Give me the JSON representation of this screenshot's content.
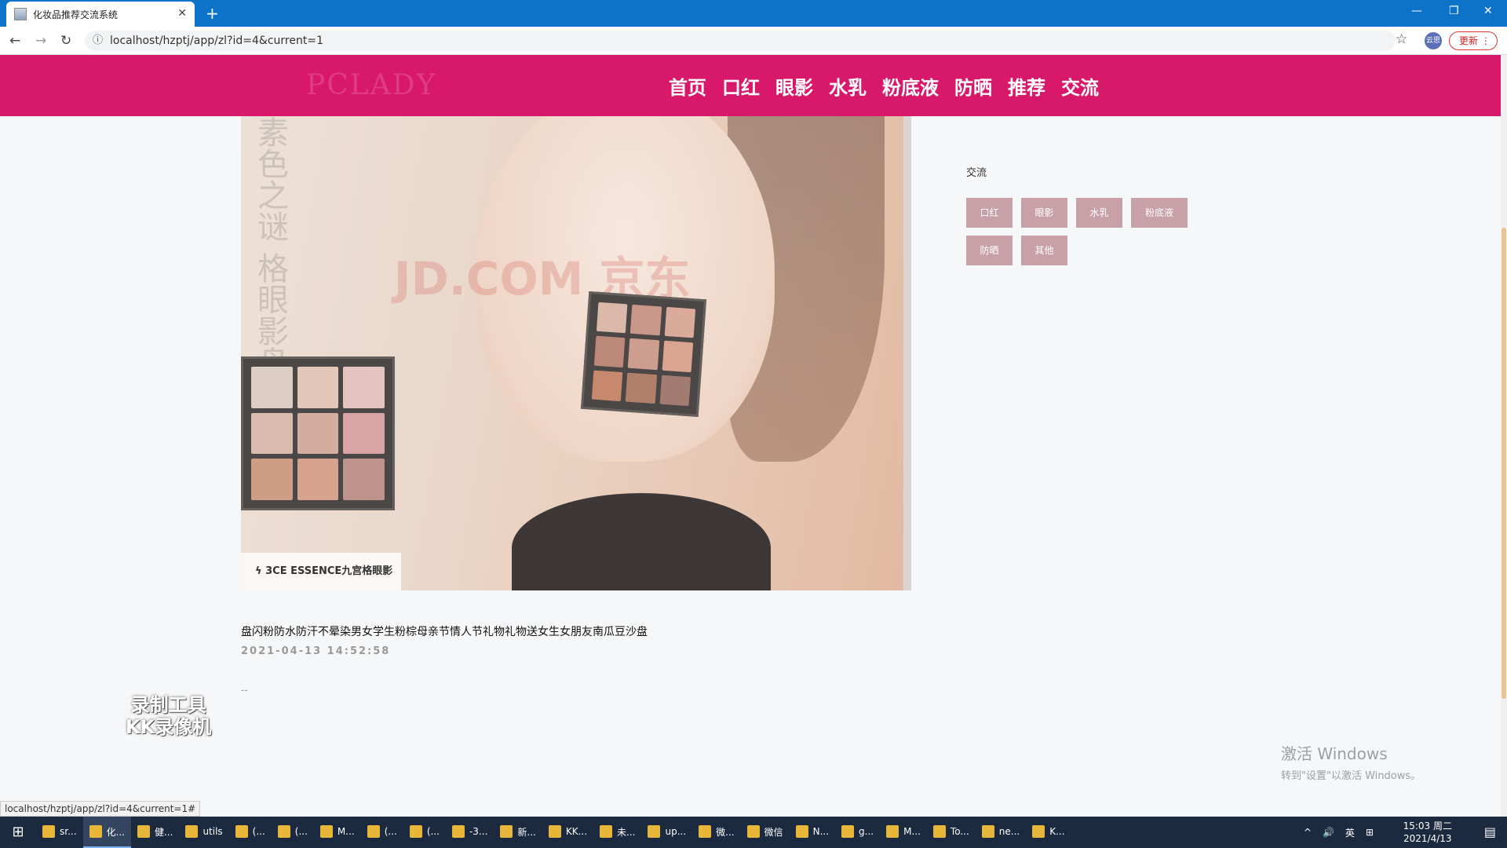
{
  "browser": {
    "tab_title": "化妆品推荐交流系统",
    "new_tab": "+",
    "url": "localhost/hzptj/app/zl?id=4&current=1",
    "update_label": "更新",
    "profile_label": "云思",
    "status_url": "localhost/hzptj/app/zl?id=4&current=1#"
  },
  "header": {
    "logo": "PCLADY",
    "nav": [
      "首页",
      "口红",
      "眼影",
      "水乳",
      "粉底液",
      "防晒",
      "推荐",
      "交流"
    ]
  },
  "hero": {
    "side_text": "素色之谜 格眼影盘",
    "watermark": "JD.COM 京东",
    "caption": "3CE ESSENCE九宫格眼影",
    "palette_label": "3CE ESSENCE"
  },
  "article": {
    "title": "盘闪粉防水防汗不晕染男女学生粉棕母亲节情人节礼物礼物送女生女朋友南瓜豆沙盘",
    "date": "2021-04-13 14:52:58",
    "body": "--"
  },
  "sidebar": {
    "title": "交流",
    "tags": [
      "口红",
      "眼影",
      "水乳",
      "粉底液",
      "防晒",
      "其他"
    ]
  },
  "overlay": {
    "recorder": "录制工具\nKK录像机",
    "activate_line1": "激活 Windows",
    "activate_line2": "转到\"设置\"以激活 Windows。"
  },
  "taskbar": {
    "items": [
      "sr...",
      "化...",
      "健...",
      "utils",
      "(...",
      "(...",
      "M...",
      "(...",
      "(...",
      "-3...",
      "新...",
      "KK...",
      "未...",
      "up...",
      "微...",
      "微信",
      "N...",
      "g...",
      "M...",
      "To...",
      "ne...",
      "K..."
    ],
    "active_index": 1,
    "tray_lang": "英",
    "time": "15:03 周二",
    "date": "2021/4/13"
  },
  "colors": {
    "brand": "#d8196b",
    "tag": "#c8a0a7",
    "titlebar": "#0c73c9"
  }
}
